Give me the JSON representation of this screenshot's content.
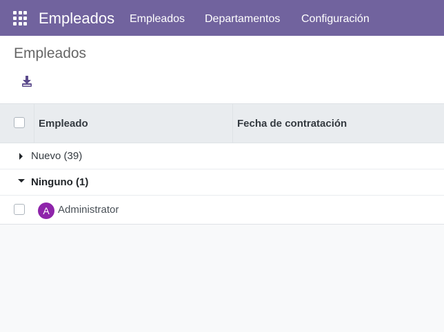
{
  "navbar": {
    "app_name": "Empleados",
    "menu": [
      "Empleados",
      "Departamentos",
      "Configuración"
    ],
    "background_color": "#71639e"
  },
  "control_panel": {
    "title": "Empleados",
    "download_icon": "download-icon"
  },
  "table": {
    "columns": [
      "Empleado",
      "Fecha de contratación"
    ],
    "groups": [
      {
        "label": "Nuevo (39)",
        "expanded": false
      },
      {
        "label": "Ninguno (1)",
        "expanded": true
      }
    ],
    "rows": [
      {
        "avatar_letter": "A",
        "name": "Administrator",
        "avatar_color": "#8e24aa"
      }
    ]
  }
}
